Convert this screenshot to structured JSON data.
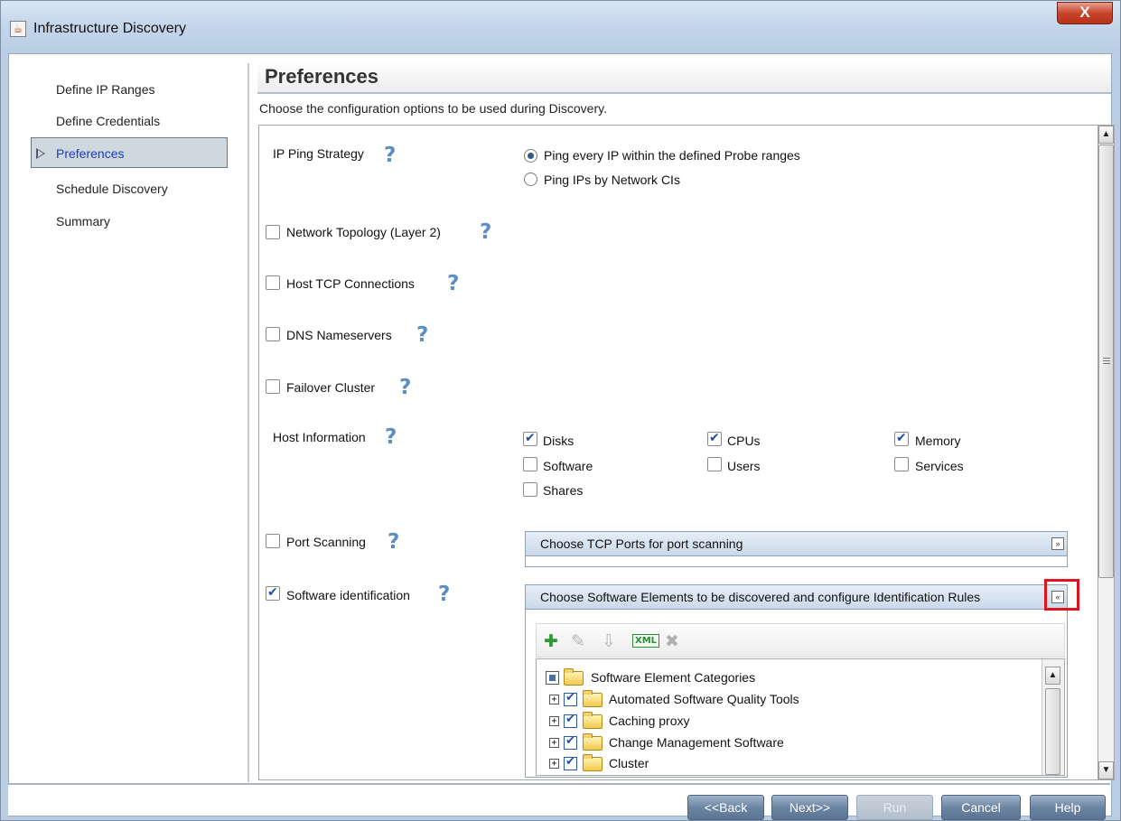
{
  "window": {
    "title": "Infrastructure Discovery",
    "close_label": "X"
  },
  "sidebar": {
    "items": [
      {
        "label": "Define IP Ranges"
      },
      {
        "label": "Define Credentials"
      },
      {
        "label": "Preferences"
      },
      {
        "label": "Schedule Discovery"
      },
      {
        "label": "Summary"
      }
    ]
  },
  "main": {
    "title": "Preferences",
    "description": "Choose the configuration options to be used during Discovery."
  },
  "ip_ping": {
    "label": "IP Ping Strategy",
    "options": [
      {
        "label": "Ping every IP within the defined Probe ranges",
        "selected": true
      },
      {
        "label": "Ping IPs by Network CIs",
        "selected": false
      }
    ]
  },
  "options": {
    "network_topology": {
      "label": "Network Topology (Layer 2)",
      "checked": false
    },
    "host_tcp": {
      "label": "Host TCP Connections",
      "checked": false
    },
    "dns": {
      "label": "DNS Nameservers",
      "checked": false
    },
    "failover": {
      "label": "Failover Cluster",
      "checked": false
    }
  },
  "host_info": {
    "label": "Host Information",
    "items": [
      {
        "label": "Disks",
        "checked": true
      },
      {
        "label": "CPUs",
        "checked": true
      },
      {
        "label": "Memory",
        "checked": true
      },
      {
        "label": "Software",
        "checked": false
      },
      {
        "label": "Users",
        "checked": false
      },
      {
        "label": "Services",
        "checked": false
      },
      {
        "label": "Shares",
        "checked": false
      }
    ]
  },
  "port_scanning": {
    "label": "Port Scanning",
    "checked": false,
    "panel_title": "Choose TCP Ports for port scanning",
    "expander_glyph": "»"
  },
  "software_id": {
    "label": "Software identification",
    "checked": true,
    "panel_title": "Choose Software Elements to be discovered and configure Identification Rules",
    "collapser_glyph": "«",
    "toolbar": {
      "add": "✚",
      "edit": "✎",
      "import": "⇩",
      "export_xml": "XML",
      "delete": "✖"
    },
    "tree": {
      "root": "Software Element Categories",
      "children": [
        {
          "label": "Automated Software Quality Tools",
          "checked": true
        },
        {
          "label": "Caching proxy",
          "checked": true
        },
        {
          "label": "Change Management Software",
          "checked": true
        },
        {
          "label": "Cluster",
          "checked": true
        }
      ]
    }
  },
  "help_glyph": "?",
  "buttons": {
    "back": "<<Back",
    "next": "Next>>",
    "run": "Run",
    "cancel": "Cancel",
    "help": "Help"
  },
  "colors": {
    "accent": "#1a3cc8",
    "highlight": "#e0141e",
    "button": "#6c85a2",
    "help_icon": "#5b8ec4"
  }
}
